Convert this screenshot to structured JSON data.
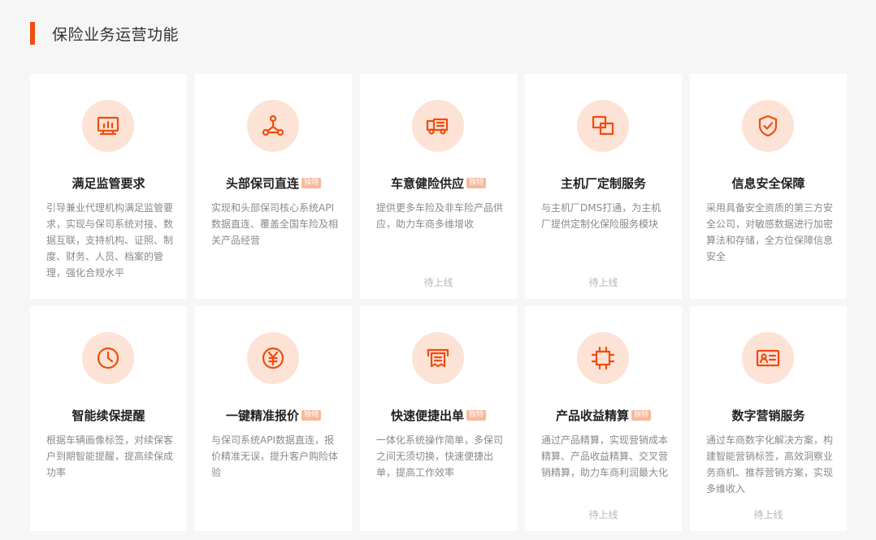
{
  "section": {
    "title": "保险业务运营功能"
  },
  "colors": {
    "accent": "#ef4d0a",
    "icon_bg": "#fde2d6",
    "badge_bg": "#f9b899",
    "desc_text": "#8a8a8a",
    "status_text": "#b5b5b5",
    "page_bg": "#f6f6f6",
    "card_bg": "#ffffff"
  },
  "cards": [
    {
      "icon": "monitor-chart-icon",
      "title": "满足监管要求",
      "badge": "",
      "desc": "引导兼业代理机构满足监管要求，实现与保司系统对接、数据互联，支持机构、证照、制度、财务、人员、档案的管理，强化合规水平",
      "status": ""
    },
    {
      "icon": "network-nodes-icon",
      "title": "头部保司直连",
      "badge": "独特",
      "desc": "实现和头部保司核心系统API数据直连、覆盖全国车险及相关产品经营",
      "status": ""
    },
    {
      "icon": "truck-icon",
      "title": "车意健险供应",
      "badge": "独特",
      "desc": "提供更多车险及非车险产品供应，助力车商多维增收",
      "status": "待上线"
    },
    {
      "icon": "overlapping-squares-icon",
      "title": "主机厂定制服务",
      "badge": "",
      "desc": "与主机厂DMS打通，为主机厂提供定制化保险服务模块",
      "status": "待上线"
    },
    {
      "icon": "shield-check-icon",
      "title": "信息安全保障",
      "badge": "",
      "desc": "采用具备安全资质的第三方安全公司，对敏感数据进行加密算法和存储，全方位保障信息安全",
      "status": ""
    },
    {
      "icon": "clock-icon",
      "title": "智能续保提醒",
      "badge": "",
      "desc": "根据车辆画像标签，对续保客户到期智能提醒，提高续保成功率",
      "status": ""
    },
    {
      "icon": "yen-coin-icon",
      "title": "一键精准报价",
      "badge": "独特",
      "desc": "与保司系统API数据直连，报价精准无误，提升客户购险体验",
      "status": ""
    },
    {
      "icon": "receipt-printer-icon",
      "title": "快速便捷出单",
      "badge": "独特",
      "desc": "一体化系统操作简单，多保司之间无须切换，快速便捷出单，提高工作效率",
      "status": ""
    },
    {
      "icon": "crop-frame-icon",
      "title": "产品收益精算",
      "badge": "独特",
      "desc": "通过产品精算，实现营销成本精算、产品收益精算、交叉营销精算，助力车商利润最大化",
      "status": "待上线"
    },
    {
      "icon": "id-card-icon",
      "title": "数字营销服务",
      "badge": "",
      "desc": "通过车商数字化解决方案，构建智能营销标签，高效洞察业务商机、推荐营销方案，实现多维收入",
      "status": "待上线"
    }
  ]
}
